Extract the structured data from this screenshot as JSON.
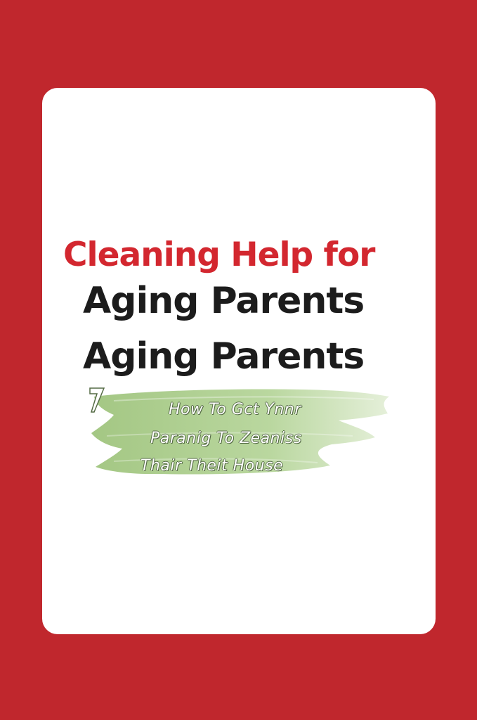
{
  "title": {
    "line1": "Cleaning Help for",
    "line2": "Aging Parents",
    "line3": "Aging Parents"
  },
  "subtitle": {
    "line1": "How To Gct Ynnr",
    "line2": "Paranig To Zeaniss",
    "line3": "Thair Theit House"
  },
  "colors": {
    "background": "#c0272d",
    "card": "#ffffff",
    "title_accent": "#d3272f",
    "title_dark": "#1c1c1c",
    "brush": "#a9cc8a"
  }
}
